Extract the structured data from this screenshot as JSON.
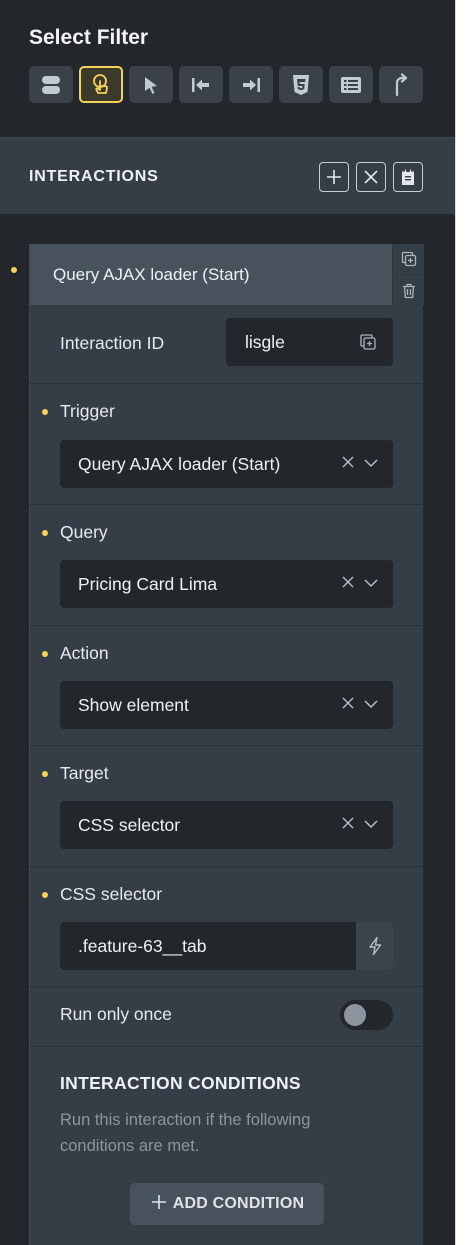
{
  "filter": {
    "title": "Select Filter",
    "icons": [
      "layers-icon",
      "pointer-hand-icon",
      "cursor-arrow-icon",
      "arrow-to-left-icon",
      "arrow-to-right-icon",
      "css3-icon",
      "list-icon",
      "share-arrow-icon"
    ],
    "active_index": 1
  },
  "interactions_bar": {
    "title": "INTERACTIONS",
    "actions": [
      "plus-icon",
      "close-icon",
      "clipboard-icon"
    ]
  },
  "interaction": {
    "header_label": "Query AJAX loader (Start)",
    "id_label": "Interaction ID",
    "id_value": "lisgle",
    "trigger": {
      "label": "Trigger",
      "value": "Query AJAX loader (Start)"
    },
    "query": {
      "label": "Query",
      "value": "Pricing Card Lima"
    },
    "action": {
      "label": "Action",
      "value": "Show element"
    },
    "target": {
      "label": "Target",
      "value": "CSS selector"
    },
    "css_selector": {
      "label": "CSS selector",
      "value": ".feature-63__tab"
    },
    "run_once": {
      "label": "Run only once",
      "enabled": false
    }
  },
  "conditions": {
    "title": "INTERACTION CONDITIONS",
    "description": "Run this interaction if the following conditions are met.",
    "add_label": "ADD CONDITION"
  },
  "colors": {
    "accent": "#f5d25a",
    "panel": "#353d46",
    "input": "#23272c"
  }
}
